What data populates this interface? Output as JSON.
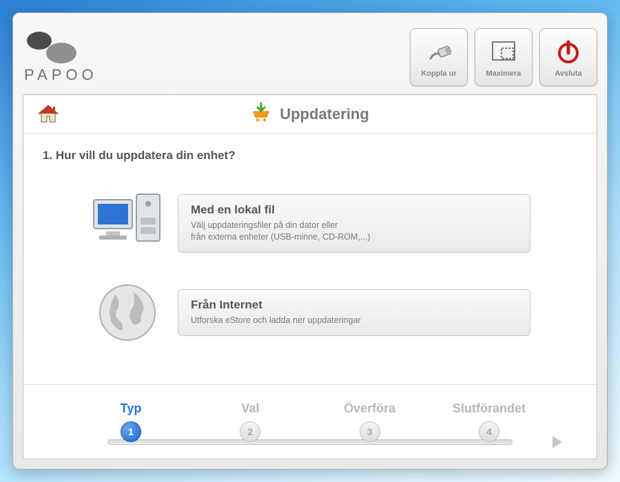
{
  "brand": "PAPOO",
  "topButtons": {
    "disconnect": "Koppla ur",
    "maximize": "Maximera",
    "quit": "Avsluta"
  },
  "panel": {
    "title": "Uppdatering",
    "question": "1. Hur vill du uppdatera din enhet?"
  },
  "options": [
    {
      "title": "Med en lokal fil",
      "desc": "Välj uppdateringsfiler på din dator eller\nfrån externa enheter (USB-minne, CD-ROM,...)"
    },
    {
      "title": "Från Internet",
      "desc": "Utforska eStore och ladda ner uppdateringar"
    }
  ],
  "steps": [
    {
      "label": "Typ",
      "num": "1",
      "active": true
    },
    {
      "label": "Val",
      "num": "2",
      "active": false
    },
    {
      "label": "Överföra",
      "num": "3",
      "active": false
    },
    {
      "label": "Slutförandet",
      "num": "4",
      "active": false
    }
  ]
}
